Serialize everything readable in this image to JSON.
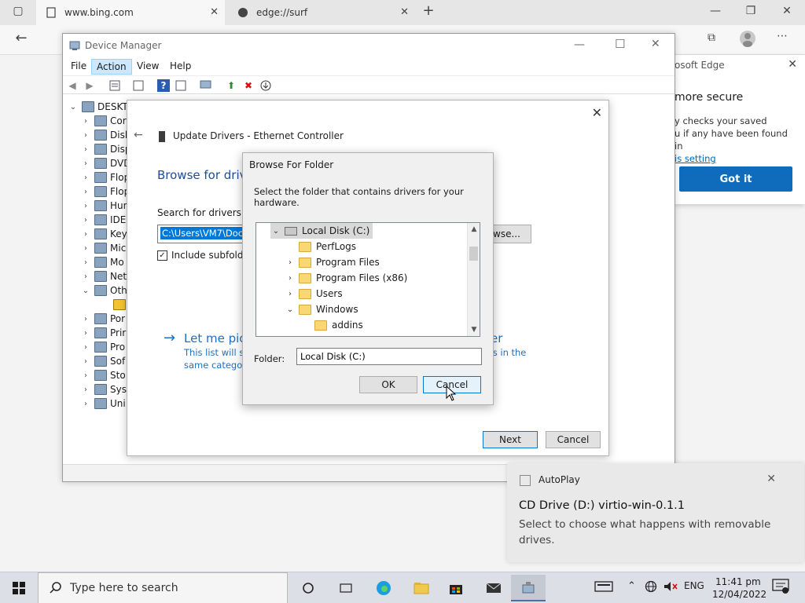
{
  "browser": {
    "tabs": [
      {
        "label": "www.bing.com"
      },
      {
        "label": "edge://surf"
      }
    ],
    "popup": {
      "title_fragment": "osoft Edge",
      "heading_fragment": "more secure",
      "body_line1": "y checks your saved",
      "body_line2": "u if any have been found in",
      "link_fragment": "is setting",
      "button": "Got it"
    }
  },
  "device_manager": {
    "title": "Device Manager",
    "menu": [
      "File",
      "Action",
      "View",
      "Help"
    ],
    "tree": [
      {
        "label": "DESKTO",
        "expanded": true,
        "level": 0
      },
      {
        "label": "Cor",
        "level": 1
      },
      {
        "label": "Disl",
        "level": 1
      },
      {
        "label": "Disp",
        "level": 1
      },
      {
        "label": "DVD",
        "level": 1
      },
      {
        "label": "Flop",
        "level": 1
      },
      {
        "label": "Flop",
        "level": 1
      },
      {
        "label": "Hun",
        "level": 1
      },
      {
        "label": "IDE",
        "level": 1
      },
      {
        "label": "Key",
        "level": 1
      },
      {
        "label": "Mic",
        "level": 1
      },
      {
        "label": "Mo",
        "level": 1
      },
      {
        "label": "Net",
        "level": 1
      },
      {
        "label": "Oth",
        "expanded": true,
        "level": 1
      },
      {
        "label": "",
        "level": 2
      },
      {
        "label": "Por",
        "level": 1
      },
      {
        "label": "Prir",
        "level": 1
      },
      {
        "label": "Pro",
        "level": 1
      },
      {
        "label": "Sof",
        "level": 1
      },
      {
        "label": "Sto",
        "level": 1
      },
      {
        "label": "Sys",
        "level": 1
      },
      {
        "label": "Uni",
        "level": 1
      }
    ]
  },
  "wizard": {
    "title": "Update Drivers - Ethernet Controller",
    "heading": "Browse for drive",
    "search_label": "Search for drivers in t",
    "path_value": "C:\\Users\\VM7\\Docu",
    "browse_label": "wse...",
    "include_subfolders": "Include subfolder",
    "pick_label_left": "Let me pick",
    "pick_label_right": "er",
    "desc_line1": "This list will sh",
    "desc_line2": "same category",
    "desc_right": "rs in the",
    "next_button": "Next",
    "cancel_button": "Cancel"
  },
  "browse_folder": {
    "title": "Browse For Folder",
    "description": "Select the folder that contains drivers for your hardware.",
    "tree": [
      {
        "label": "Local Disk (C:)",
        "expanded": true,
        "type": "drive"
      },
      {
        "label": "PerfLogs",
        "type": "folder"
      },
      {
        "label": "Program Files",
        "type": "folder",
        "expandable": true
      },
      {
        "label": "Program Files (x86)",
        "type": "folder",
        "expandable": true
      },
      {
        "label": "Users",
        "type": "folder",
        "expandable": true
      },
      {
        "label": "Windows",
        "type": "folder",
        "expanded": true
      },
      {
        "label": "addins",
        "type": "folder"
      }
    ],
    "folder_label": "Folder:",
    "folder_value": "Local Disk (C:)",
    "ok_button": "OK",
    "cancel_button": "Cancel"
  },
  "toast": {
    "app": "AutoPlay",
    "title": "CD Drive (D:) virtio-win-0.1.1",
    "body": "Select to choose what happens with removable drives."
  },
  "taskbar": {
    "search_placeholder": "Type here to search",
    "language": "ENG",
    "time": "11:41 pm",
    "date": "12/04/2022"
  },
  "colors": {
    "accent": "#0078d7",
    "link": "#1e6fc2",
    "folder": "#f8d775",
    "taskbar": "#dcdfe6"
  }
}
